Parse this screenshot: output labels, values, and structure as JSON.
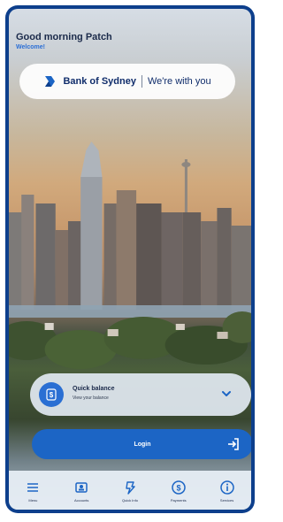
{
  "header": {
    "greeting": "Good morning Patch",
    "welcome": "Welcome!"
  },
  "brand": {
    "name": "Bank of Sydney",
    "tagline": "We're with you"
  },
  "quick_balance": {
    "title": "Quick balance",
    "subtitle": "View your balance"
  },
  "login": {
    "label": "Login"
  },
  "tabbar": {
    "items": [
      {
        "label": "Menu",
        "icon": "menu-icon"
      },
      {
        "label": "Accounts",
        "icon": "accounts-icon"
      },
      {
        "label": "Quick Info",
        "icon": "quick-info-icon"
      },
      {
        "label": "Payments",
        "icon": "payments-icon"
      },
      {
        "label": "Services",
        "icon": "services-icon"
      }
    ]
  },
  "colors": {
    "frame": "#0d3f8c",
    "accent": "#1c65c5",
    "brand_text": "#102d6b"
  }
}
